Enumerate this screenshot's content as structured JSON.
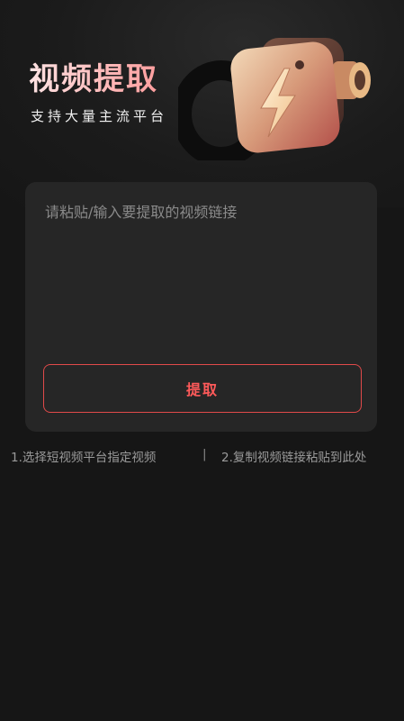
{
  "header": {
    "title": "视频提取",
    "subtitle": "支持大量主流平台"
  },
  "input": {
    "placeholder": "请粘贴/输入要提取的视频链接",
    "value": ""
  },
  "extract_button": {
    "label": "提取"
  },
  "tips": {
    "step1": "1.选择短视频平台指定视频",
    "separator": "|",
    "step2": "2.复制视频链接粘贴到此处"
  },
  "colors": {
    "background": "#161616",
    "card": "#262626",
    "accent": "#e14a4a",
    "title_gradient_start": "#ffe3e3",
    "title_gradient_end": "#ff9e9e"
  },
  "icons": {
    "hero": "lightning-camera-icon"
  }
}
